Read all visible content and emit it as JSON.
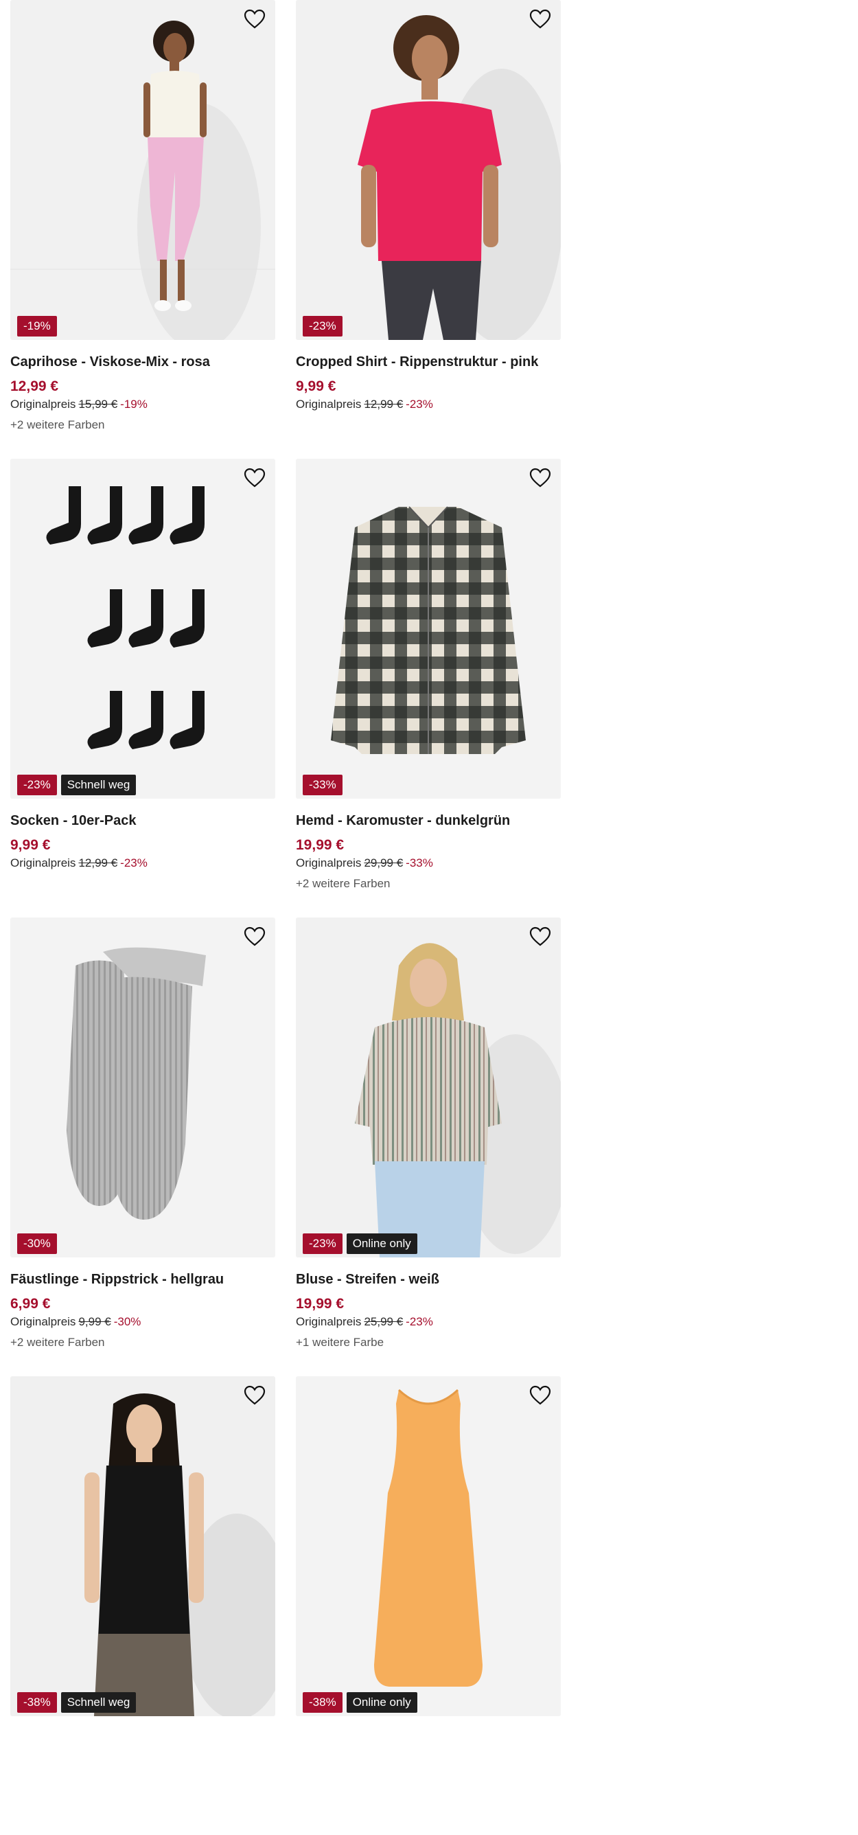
{
  "products": [
    {
      "name": "Caprihose - Viskose-Mix - rosa",
      "price": "12,99 €",
      "original_label": "Originalpreis",
      "original_price": "15,99 €",
      "discount": "-19%",
      "badge": "-19%",
      "extra_badge": "",
      "colors": "+2 weitere Farben",
      "image": "woman-white-top-pink-capri"
    },
    {
      "name": "Cropped Shirt - Rippenstruktur - pink",
      "price": "9,99 €",
      "original_label": "Originalpreis",
      "original_price": "12,99 €",
      "discount": "-23%",
      "badge": "-23%",
      "extra_badge": "",
      "colors": "",
      "image": "woman-pink-tshirt"
    },
    {
      "name": "Socken - 10er-Pack",
      "price": "9,99 €",
      "original_label": "Originalpreis",
      "original_price": "12,99 €",
      "discount": "-23%",
      "badge": "-23%",
      "extra_badge": "Schnell weg",
      "colors": "",
      "image": "black-socks"
    },
    {
      "name": "Hemd - Karomuster - dunkelgrün",
      "price": "19,99 €",
      "original_label": "Originalpreis",
      "original_price": "29,99 €",
      "discount": "-33%",
      "badge": "-33%",
      "extra_badge": "",
      "colors": "+2 weitere Farben",
      "image": "checked-shirt"
    },
    {
      "name": "Fäustlinge - Rippstrick - hellgrau",
      "price": "6,99 €",
      "original_label": "Originalpreis",
      "original_price": "9,99 €",
      "discount": "-30%",
      "badge": "-30%",
      "extra_badge": "",
      "colors": "+2 weitere Farben",
      "image": "grey-mittens"
    },
    {
      "name": "Bluse - Streifen - weiß",
      "price": "19,99 €",
      "original_label": "Originalpreis",
      "original_price": "25,99 €",
      "discount": "-23%",
      "badge": "-23%",
      "extra_badge": "Online only",
      "colors": "+1 weitere Farbe",
      "image": "woman-striped-blouse"
    },
    {
      "name": "",
      "price": "",
      "original_label": "",
      "original_price": "",
      "discount": "",
      "badge": "-38%",
      "extra_badge": "Schnell weg",
      "colors": "",
      "image": "woman-black-sleeveless-top"
    },
    {
      "name": "",
      "price": "",
      "original_label": "",
      "original_price": "",
      "discount": "",
      "badge": "-38%",
      "extra_badge": "Online only",
      "colors": "",
      "image": "orange-dress"
    }
  ],
  "icons": {
    "wishlist": "heart-outline-icon"
  },
  "colors": {
    "sale": "#a50f2d",
    "badge_dark": "#1e1e1e",
    "image_bg": "#f3f3f3"
  }
}
